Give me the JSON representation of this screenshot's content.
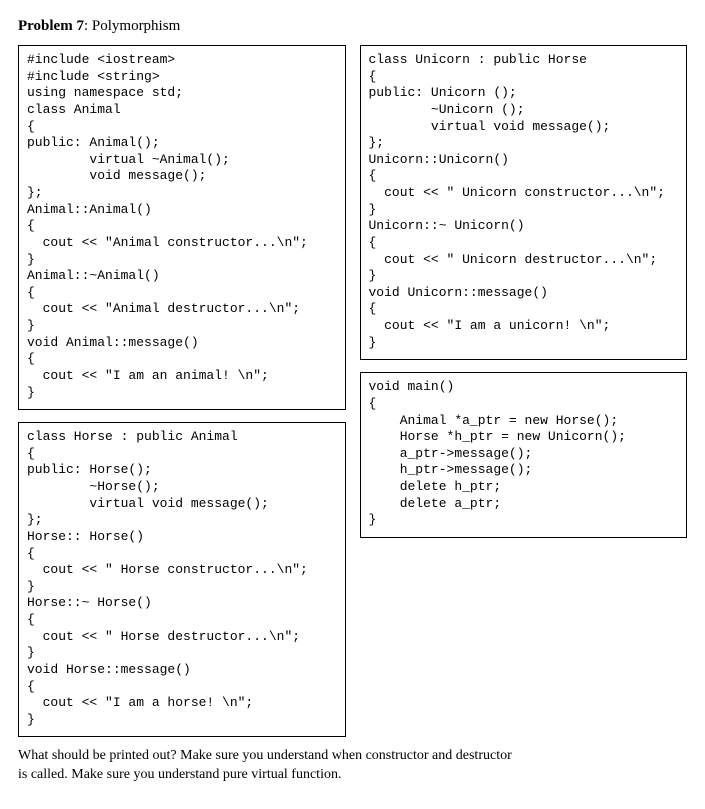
{
  "header": {
    "label_bold": "Problem 7",
    "label_rest": ": Polymorphism"
  },
  "code": {
    "animal": "#include <iostream>\n#include <string>\nusing namespace std;\nclass Animal\n{\npublic: Animal();\n        virtual ~Animal();\n        void message();\n};\nAnimal::Animal()\n{\n  cout << \"Animal constructor...\\n\";\n}\nAnimal::~Animal()\n{\n  cout << \"Animal destructor...\\n\";\n}\nvoid Animal::message()\n{\n  cout << \"I am an animal! \\n\";\n}",
    "horse": "class Horse : public Animal\n{\npublic: Horse();\n        ~Horse();\n        virtual void message();\n};\nHorse:: Horse()\n{\n  cout << \" Horse constructor...\\n\";\n}\nHorse::~ Horse()\n{\n  cout << \" Horse destructor...\\n\";\n}\nvoid Horse::message()\n{\n  cout << \"I am a horse! \\n\";\n}",
    "unicorn": "class Unicorn : public Horse\n{\npublic: Unicorn ();\n        ~Unicorn ();\n        virtual void message();\n};\nUnicorn::Unicorn()\n{\n  cout << \" Unicorn constructor...\\n\";\n}\nUnicorn::~ Unicorn()\n{\n  cout << \" Unicorn destructor...\\n\";\n}\nvoid Unicorn::message()\n{\n  cout << \"I am a unicorn! \\n\";\n}",
    "main": "void main()\n{\n    Animal *a_ptr = new Horse();\n    Horse *h_ptr = new Unicorn();\n    a_ptr->message();\n    h_ptr->message();\n    delete h_ptr;\n    delete a_ptr;\n}"
  },
  "question": {
    "line1": "What should be printed out? Make sure you understand when constructor and destructor",
    "line2": "is called. Make sure you understand pure virtual function."
  }
}
